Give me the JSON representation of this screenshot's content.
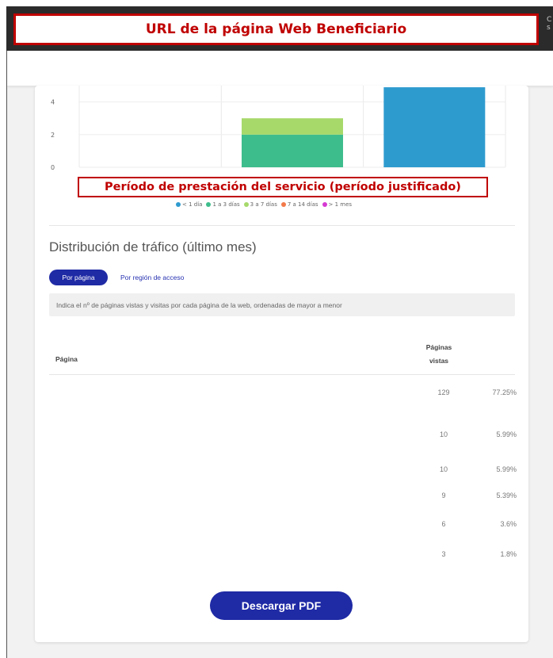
{
  "banner": {
    "url_label": "URL de la página Web Beneficiario"
  },
  "chart_data": {
    "type": "bar",
    "stacked": true,
    "categories": [
      "",
      "",
      ""
    ],
    "series": [
      {
        "name": "< 1 día",
        "color": "#2e9bcf",
        "values": [
          0,
          0,
          4.9
        ]
      },
      {
        "name": "1 a 3 días",
        "color": "#3ebd8c",
        "values": [
          0,
          2,
          0
        ]
      },
      {
        "name": "3 a 7 días",
        "color": "#a6d96a",
        "values": [
          0,
          1,
          0
        ]
      },
      {
        "name": "7 a 14 días",
        "color": "#f2794a",
        "values": [
          0,
          0,
          0
        ]
      },
      {
        "name": "> 1 mes",
        "color": "#d63ad3",
        "values": [
          0,
          0,
          0
        ]
      }
    ],
    "y_ticks": [
      "0",
      "2",
      "4"
    ],
    "ylim": [
      0,
      5
    ],
    "grid": true,
    "legend_position": "bottom"
  },
  "period_label": "Período de prestación del servicio (período justificado)",
  "section": {
    "title": "Distribución de tráfico (último mes)",
    "tab_active": "Por página",
    "tab_inactive": "Por región de acceso",
    "info": "Indica el nº de páginas vistas y visitas por cada página de la web, ordenadas de mayor a menor"
  },
  "table": {
    "col_page": "Página",
    "col_views_line1": "Páginas",
    "col_views_line2": "vistas",
    "rows": [
      {
        "views": "129",
        "pct": "77.25%"
      },
      {
        "views": "10",
        "pct": "5.99%"
      },
      {
        "views": "10",
        "pct": "5.99%"
      },
      {
        "views": "9",
        "pct": "5.39%"
      },
      {
        "views": "6",
        "pct": "3.6%"
      },
      {
        "views": "3",
        "pct": "1.8%"
      }
    ]
  },
  "buttons": {
    "download_pdf": "Descargar PDF"
  }
}
